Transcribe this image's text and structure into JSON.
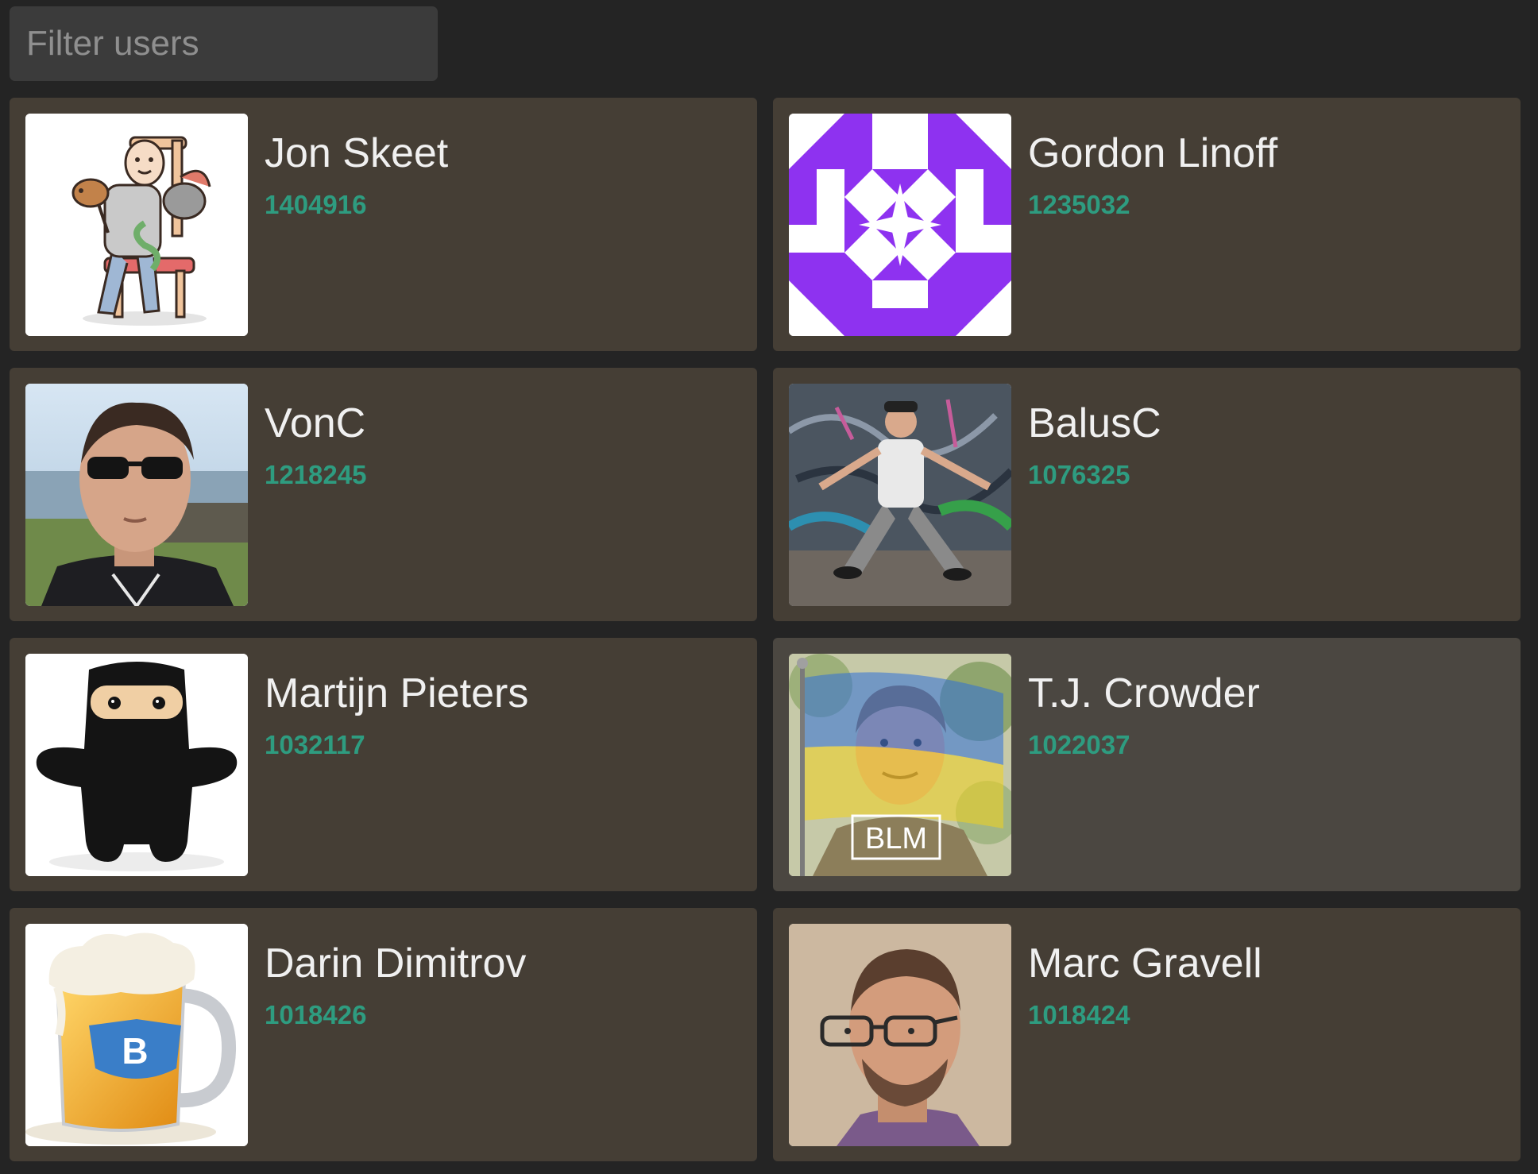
{
  "filter": {
    "placeholder": "Filter users",
    "value": ""
  },
  "colors": {
    "page_background": "#242424",
    "card_background": "#453e35",
    "card_hover_background": "#4b4741",
    "name_text": "#f0f0f0",
    "reputation_text": "#2e9c80",
    "input_background": "#3b3b3b"
  },
  "users": [
    {
      "name": "Jon Skeet",
      "reputation": "1404916",
      "avatar": "cartoon-man-in-chair-avatar"
    },
    {
      "name": "Gordon Linoff",
      "reputation": "1235032",
      "avatar": "purple-identicon-avatar"
    },
    {
      "name": "VonC",
      "reputation": "1218245",
      "avatar": "man-in-sunglasses-photo-avatar"
    },
    {
      "name": "BalusC",
      "reputation": "1076325",
      "avatar": "man-posing-graffiti-photo-avatar"
    },
    {
      "name": "Martijn Pieters",
      "reputation": "1032117",
      "avatar": "plush-ninja-avatar"
    },
    {
      "name": "T.J. Crowder",
      "reputation": "1022037",
      "avatar": "ukraine-flag-blm-photo-avatar",
      "avatar_text": "BLM"
    },
    {
      "name": "Darin Dimitrov",
      "reputation": "1018426",
      "avatar": "beer-mug-avatar",
      "avatar_text": "B"
    },
    {
      "name": "Marc Gravell",
      "reputation": "1018424",
      "avatar": "man-with-glasses-photo-avatar"
    }
  ]
}
